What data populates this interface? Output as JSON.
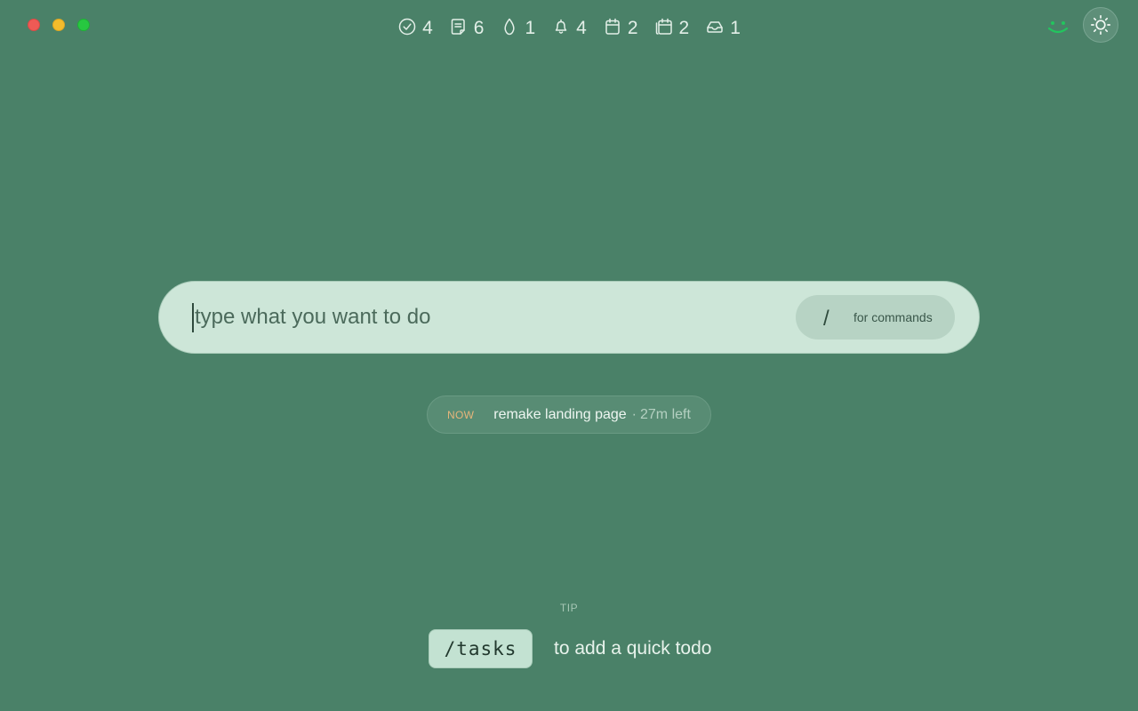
{
  "window": {
    "traffic_lights": [
      "close",
      "minimize",
      "maximize"
    ]
  },
  "counters": [
    {
      "name": "tasks",
      "icon": "check-circle-icon",
      "count": "4"
    },
    {
      "name": "notes",
      "icon": "note-icon",
      "count": "6"
    },
    {
      "name": "habits",
      "icon": "drop-icon",
      "count": "1"
    },
    {
      "name": "reminders",
      "icon": "bell-icon",
      "count": "4"
    },
    {
      "name": "calendar",
      "icon": "calendar-icon",
      "count": "2"
    },
    {
      "name": "events",
      "icon": "calendar-stack-icon",
      "count": "2"
    },
    {
      "name": "inbox",
      "icon": "inbox-tray-icon",
      "count": "1"
    }
  ],
  "status": {
    "mood_icon": "smiley-icon",
    "theme_icon": "sun-icon",
    "mood_color": "#22c55e"
  },
  "command_bar": {
    "placeholder": "type what you want to do",
    "value": "",
    "hint_key": "/",
    "hint_text": "for commands"
  },
  "now": {
    "label": "NOW",
    "task": "remake landing page",
    "separator": "·",
    "time_left": "27m left"
  },
  "tip": {
    "label": "TIP",
    "command": "/tasks",
    "text": "to add a quick todo"
  },
  "colors": {
    "background": "#4a8168",
    "input_bg": "#cde6d8",
    "now_accent": "#e7b57b"
  }
}
